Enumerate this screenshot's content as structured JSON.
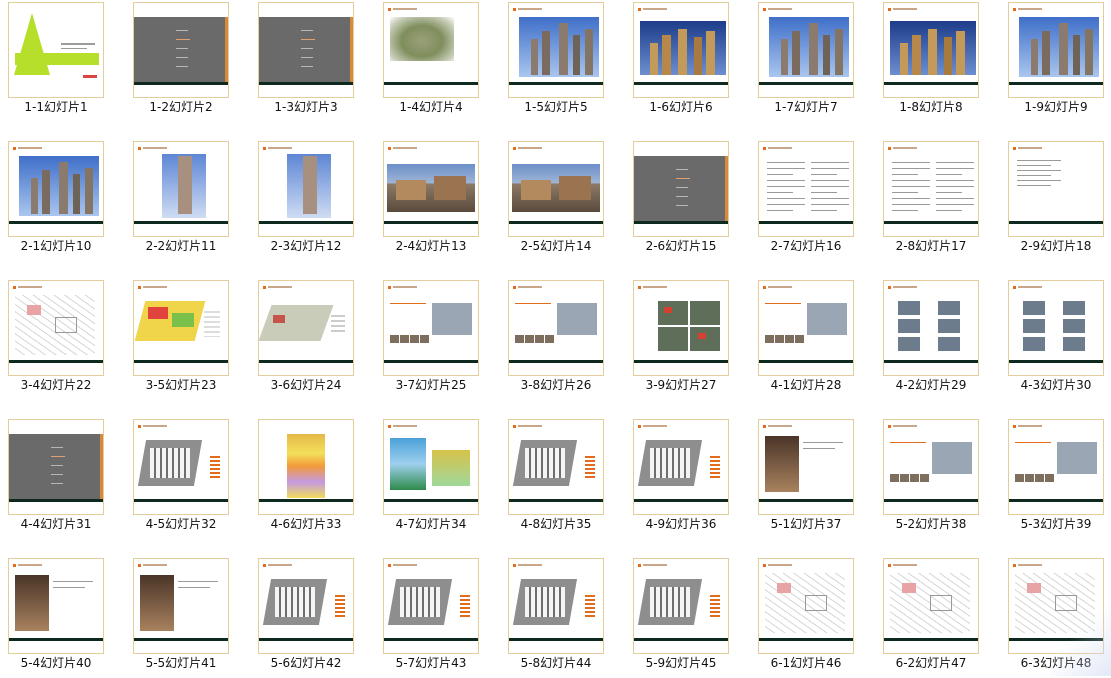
{
  "slides": [
    {
      "caption": "1-1幻灯片1",
      "kind": "cover"
    },
    {
      "caption": "1-2幻灯片2",
      "kind": "menu"
    },
    {
      "caption": "1-3幻灯片3",
      "kind": "menu"
    },
    {
      "caption": "1-4幻灯片4",
      "kind": "aerial"
    },
    {
      "caption": "1-5幻灯片5",
      "kind": "towers-day"
    },
    {
      "caption": "1-6幻灯片6",
      "kind": "towers-dusk"
    },
    {
      "caption": "1-7幻灯片7",
      "kind": "towers-day"
    },
    {
      "caption": "1-8幻灯片8",
      "kind": "towers-dusk"
    },
    {
      "caption": "1-9幻灯片9",
      "kind": "towers-day"
    },
    {
      "caption": "2-1幻灯片10",
      "kind": "towers-day"
    },
    {
      "caption": "2-2幻灯片11",
      "kind": "tower-single"
    },
    {
      "caption": "2-3幻灯片12",
      "kind": "tower-single"
    },
    {
      "caption": "2-4幻灯片13",
      "kind": "shops"
    },
    {
      "caption": "2-5幻灯片14",
      "kind": "shops"
    },
    {
      "caption": "2-6幻灯片15",
      "kind": "menu"
    },
    {
      "caption": "2-7幻灯片16",
      "kind": "text"
    },
    {
      "caption": "2-8幻灯片17",
      "kind": "text"
    },
    {
      "caption": "2-9幻灯片18",
      "kind": "text-short"
    },
    {
      "caption": "3-4幻灯片22",
      "kind": "plan-line"
    },
    {
      "caption": "3-5幻灯片23",
      "kind": "plan-color"
    },
    {
      "caption": "3-6幻灯片24",
      "kind": "plan-green"
    },
    {
      "caption": "3-7幻灯片25",
      "kind": "photos-map"
    },
    {
      "caption": "3-8幻灯片26",
      "kind": "photos-map"
    },
    {
      "caption": "3-9幻灯片27",
      "kind": "map-grid"
    },
    {
      "caption": "4-1幻灯片28",
      "kind": "photos-map"
    },
    {
      "caption": "4-2幻灯片29",
      "kind": "diagram-grid"
    },
    {
      "caption": "4-3幻灯片30",
      "kind": "diagram-grid"
    },
    {
      "caption": "4-4幻灯片31",
      "kind": "menu"
    },
    {
      "caption": "4-5幻灯片32",
      "kind": "site-plan"
    },
    {
      "caption": "4-6幻灯片33",
      "kind": "table-color"
    },
    {
      "caption": "4-7幻灯片34",
      "kind": "table-blue"
    },
    {
      "caption": "4-8幻灯片35",
      "kind": "site-plan"
    },
    {
      "caption": "4-9幻灯片36",
      "kind": "site-plan"
    },
    {
      "caption": "5-1幻灯片37",
      "kind": "interiors"
    },
    {
      "caption": "5-2幻灯片38",
      "kind": "photos-map"
    },
    {
      "caption": "5-3幻灯片39",
      "kind": "photos-map"
    },
    {
      "caption": "5-4幻灯片40",
      "kind": "interiors"
    },
    {
      "caption": "5-5幻灯片41",
      "kind": "interiors"
    },
    {
      "caption": "5-6幻灯片42",
      "kind": "site-plan"
    },
    {
      "caption": "5-7幻灯片43",
      "kind": "site-plan"
    },
    {
      "caption": "5-8幻灯片44",
      "kind": "site-plan"
    },
    {
      "caption": "5-9幻灯片45",
      "kind": "site-plan"
    },
    {
      "caption": "6-1幻灯片46",
      "kind": "plan-line"
    },
    {
      "caption": "6-2幻灯片47",
      "kind": "plan-line"
    },
    {
      "caption": "6-3幻灯片48",
      "kind": "plan-line"
    }
  ],
  "colors": {
    "thumb_border": "#e3cd9c",
    "footer_bar": "#0e2a1e",
    "accent_orange": "#e06c1c",
    "cover_lime": "#b6df2c",
    "menu_gray": "#6a6a6a"
  }
}
